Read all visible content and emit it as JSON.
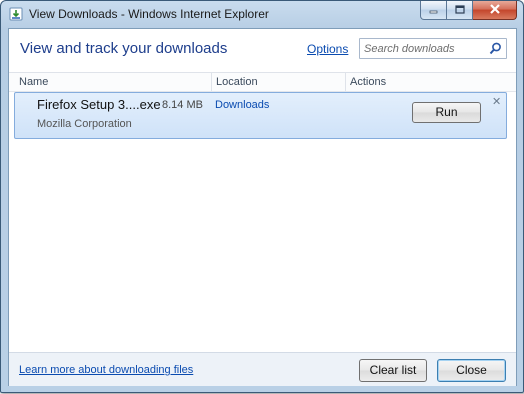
{
  "window": {
    "title": "View Downloads - Windows Internet Explorer"
  },
  "header": {
    "heading": "View and track your downloads",
    "options_label": "Options",
    "search_placeholder": "Search downloads"
  },
  "columns": {
    "name": "Name",
    "location": "Location",
    "actions": "Actions"
  },
  "downloads": [
    {
      "filename": "Firefox Setup 3....exe",
      "size": "8.14 MB",
      "publisher": "Mozilla Corporation",
      "location": "Downloads",
      "action_label": "Run",
      "dismiss_glyph": "✕"
    }
  ],
  "footer": {
    "learn_more_label": "Learn more about downloading files",
    "clear_list_label": "Clear list",
    "close_label": "Close"
  },
  "icons": {
    "app": "ie-downloads-icon",
    "search": "search-icon",
    "minimize": "minimize-icon",
    "maximize": "maximize-icon",
    "close": "close-icon"
  },
  "colors": {
    "heading": "#1e3e8c",
    "link": "#0a4bb0",
    "row_selected": "#cfe2f8",
    "title_bar": "#c9dcee"
  }
}
